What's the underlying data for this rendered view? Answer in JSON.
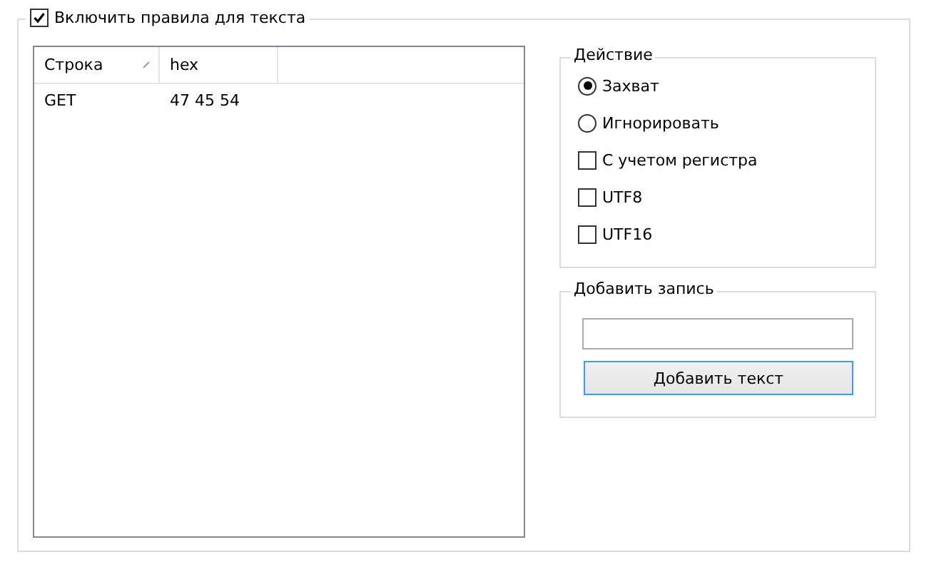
{
  "rules_group": {
    "label": "Включить правила для текста",
    "checked": true
  },
  "table": {
    "columns": [
      {
        "label": "Строка",
        "sorted": true
      },
      {
        "label": "hex",
        "sorted": false
      }
    ],
    "rows": [
      {
        "cells": [
          "GET",
          "47 45 54"
        ],
        "selected": false
      }
    ]
  },
  "action_group": {
    "title": "Действие",
    "options": [
      {
        "kind": "radio",
        "label": "Захват",
        "selected": true
      },
      {
        "kind": "radio",
        "label": "Игнорировать",
        "selected": false
      },
      {
        "kind": "checkbox",
        "label": "С учетом регистра",
        "checked": false
      },
      {
        "kind": "checkbox",
        "label": "UTF8",
        "checked": false
      },
      {
        "kind": "checkbox",
        "label": "UTF16",
        "checked": false
      }
    ]
  },
  "add_group": {
    "title": "Добавить запись",
    "button": "Добавить текст"
  }
}
